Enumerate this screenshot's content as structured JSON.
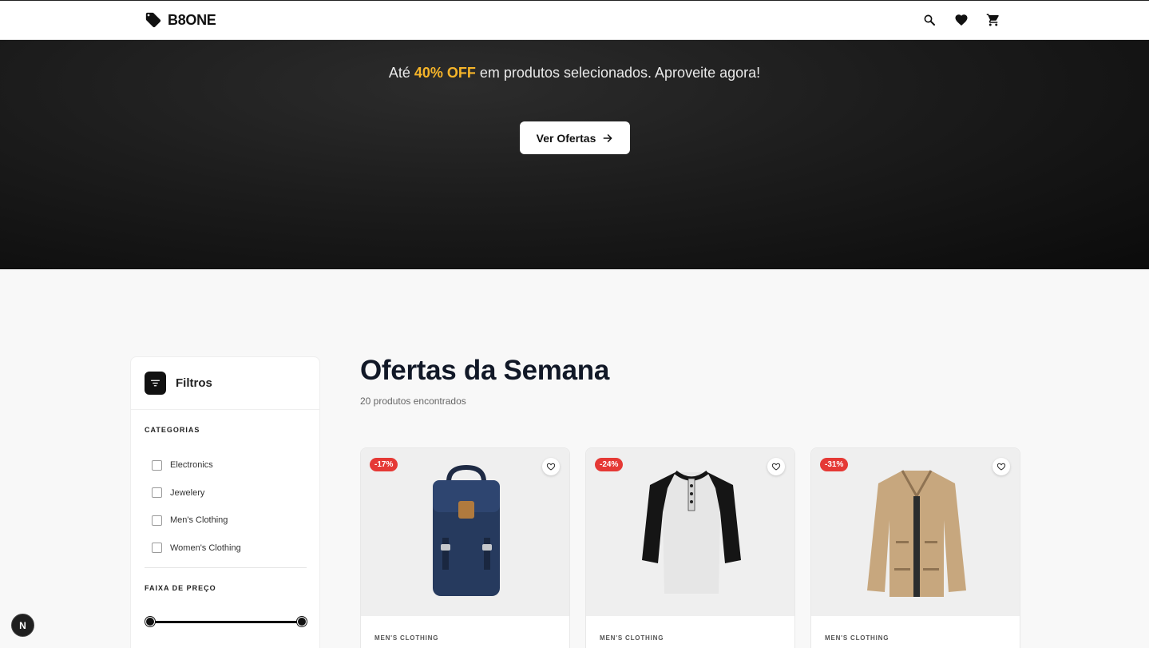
{
  "header": {
    "brand": "B8ONE",
    "icons": [
      "tag-icon",
      "search-icon",
      "heart-icon",
      "cart-icon"
    ]
  },
  "hero": {
    "text_before": "Até ",
    "highlight": "40% OFF",
    "text_after": " em produtos selecionados. Aproveite agora!",
    "cta_label": "Ver Ofertas",
    "highlight_color": "#f5b429"
  },
  "filters": {
    "title": "Filtros",
    "categories_label": "CATEGORIAS",
    "categories": [
      "Electronics",
      "Jewelery",
      "Men's Clothing",
      "Women's Clothing"
    ],
    "price_label": "FAIXA DE PREÇO"
  },
  "main": {
    "title": "Ofertas da Semana",
    "subtitle": "20 produtos encontrados"
  },
  "products": [
    {
      "discount": "-17%",
      "category": "MEN'S CLOTHING",
      "image": "backpack"
    },
    {
      "discount": "-24%",
      "category": "MEN'S CLOTHING",
      "image": "raglan-shirt"
    },
    {
      "discount": "-31%",
      "category": "MEN'S CLOTHING",
      "image": "jacket"
    }
  ],
  "dev_badge": "N",
  "colors": {
    "accent": "#f5b429",
    "badge": "#e53935",
    "dark": "#111111"
  }
}
